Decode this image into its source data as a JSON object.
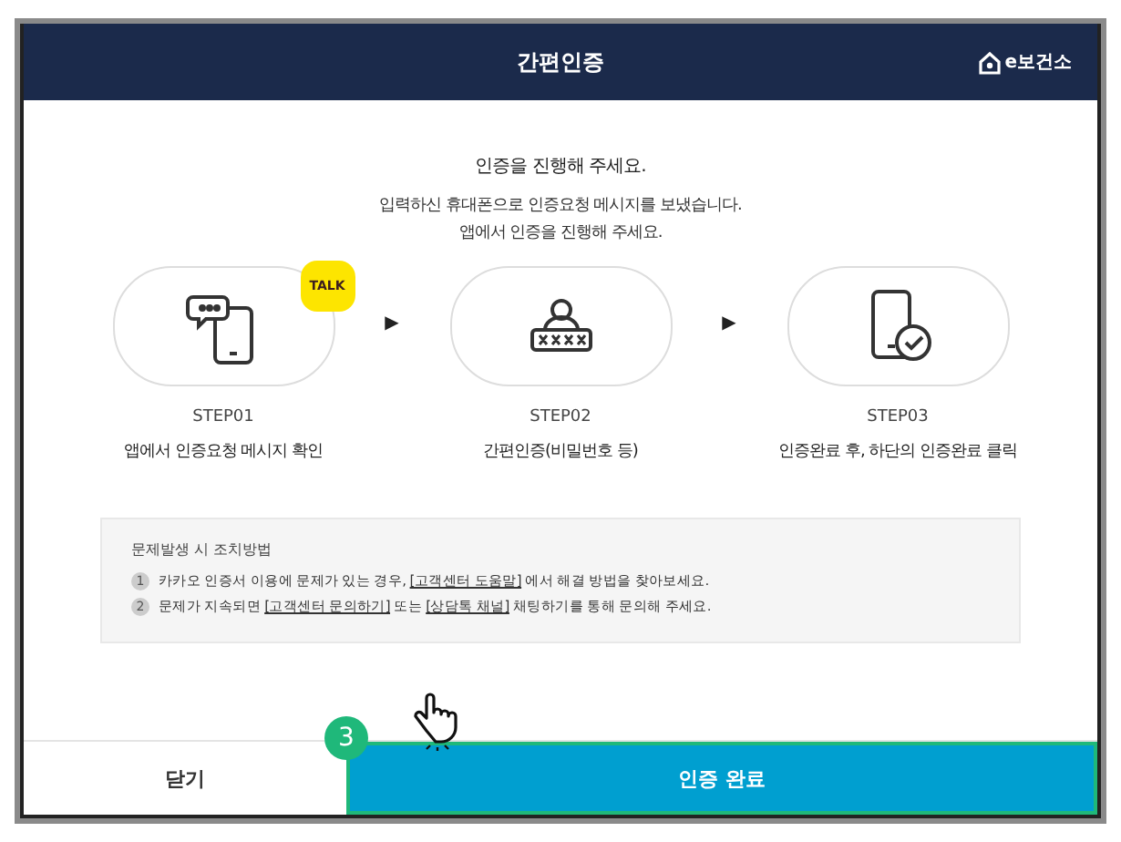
{
  "window": {
    "title": "간편인증",
    "brand": "e보건소"
  },
  "intro": {
    "heading": "인증을 진행해 주세요.",
    "lines": [
      "입력하신 휴대폰으로 인증요청 메시지를 보냈습니다.",
      "앱에서 인증을 진행해 주세요."
    ]
  },
  "steps": [
    {
      "kind": "phone-chat",
      "badge": "TALK",
      "label": "STEP01",
      "desc": "앱에서 인증요청 메시지 확인"
    },
    {
      "kind": "password",
      "label": "STEP02",
      "desc": "간편인증(비밀번호 등)"
    },
    {
      "kind": "phone-check",
      "label": "STEP03",
      "desc": "인증완료 후, 하단의 인증완료 클릭"
    }
  ],
  "step_separator": "▶",
  "notice": {
    "title": "문제발생 시 조치방법",
    "items": [
      {
        "number": "1",
        "parts": [
          {
            "text": "카카오 인증서 이용에 문제가 있는 경우, ",
            "link": false
          },
          {
            "text": "[고객센터 도움말]",
            "link": true
          },
          {
            "text": " 에서 해결 방법을 찾아보세요.",
            "link": false
          }
        ]
      },
      {
        "number": "2",
        "parts": [
          {
            "text": "문제가 지속되면 ",
            "link": false
          },
          {
            "text": "[고객센터 문의하기]",
            "link": true
          },
          {
            "text": " 또는 ",
            "link": false
          },
          {
            "text": "[상담톡 채널]",
            "link": true
          },
          {
            "text": " 채팅하기를 통해 문의해 주세요.",
            "link": false
          }
        ]
      }
    ]
  },
  "buttons": [
    {
      "label": "닫기",
      "kind": "secondary"
    },
    {
      "label": "인증 완료",
      "kind": "primary",
      "callout": "3"
    }
  ]
}
